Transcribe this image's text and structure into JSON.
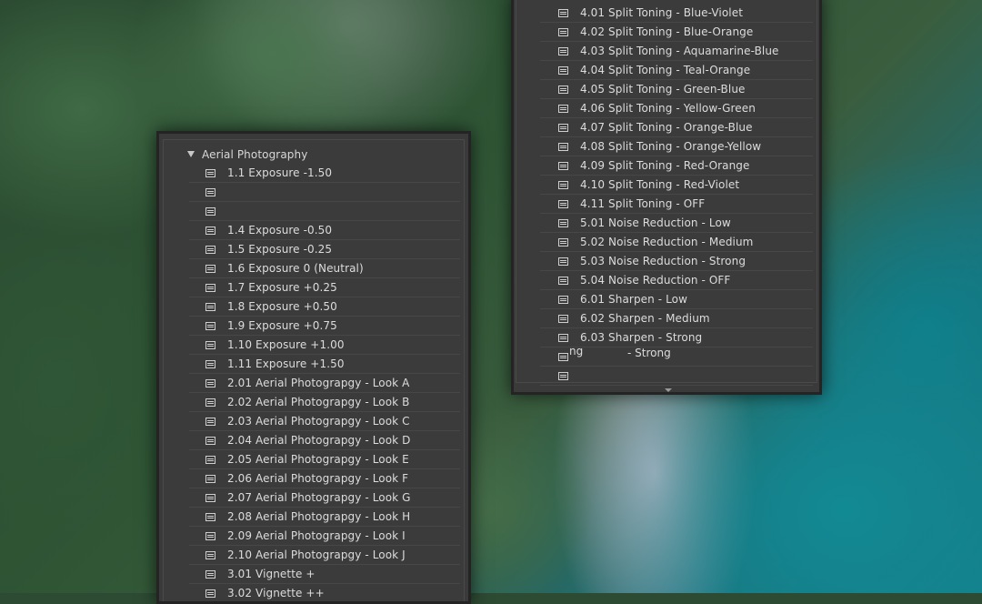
{
  "left_panel": {
    "folder_name": "Aerial Photography",
    "presets": [
      "1.1 Exposure -1.50",
      "",
      "",
      "1.4 Exposure -0.50",
      "1.5 Exposure -0.25",
      "1.6 Exposure 0 (Neutral)",
      "1.7 Exposure +0.25",
      "1.8 Exposure +0.50",
      "1.9 Exposure +0.75",
      "1.10 Exposure +1.00",
      "1.11 Exposure +1.50",
      "2.01 Aerial Photograpgy - Look A",
      "2.02 Aerial Photograpgy - Look B",
      "2.03 Aerial Photograpgy - Look C",
      "2.04 Aerial Photograpgy - Look D",
      "2.05 Aerial Photograpgy - Look E",
      "2.06 Aerial Photograpgy - Look F",
      "2.07 Aerial Photograpgy - Look G",
      "2.08 Aerial Photograpgy - Look H",
      "2.09 Aerial Photograpgy - Look I",
      "2.10 Aerial Photograpgy - Look J",
      "3.01 Vignette +",
      "3.02 Vignette ++"
    ]
  },
  "right_panel": {
    "presets": [
      "4.01 Split Toning - Blue-Violet",
      "4.02 Split Toning - Blue-Orange",
      "4.03 Split Toning - Aquamarine-Blue",
      "4.04 Split Toning - Teal-Orange",
      "4.05 Split Toning - Green-Blue",
      "4.06 Split Toning - Yellow-Green",
      "4.07 Split Toning - Orange-Blue",
      "4.08 Split Toning - Orange-Yellow",
      "4.09 Split Toning - Red-Orange",
      "4.10 Split Toning - Red-Violet",
      "4.11 Split Toning - OFF",
      "5.01 Noise Reduction - Low",
      "5.02 Noise Reduction - Medium",
      "5.03 Noise Reduction - Strong",
      "5.04 Noise Reduction - OFF",
      "6.01 Sharpen - Low",
      "6.02 Sharpen - Medium",
      "6.03 Sharpen - Strong",
      "",
      ""
    ],
    "ghost_text_1": "- Strong",
    "ghost_text_2": "ng"
  }
}
